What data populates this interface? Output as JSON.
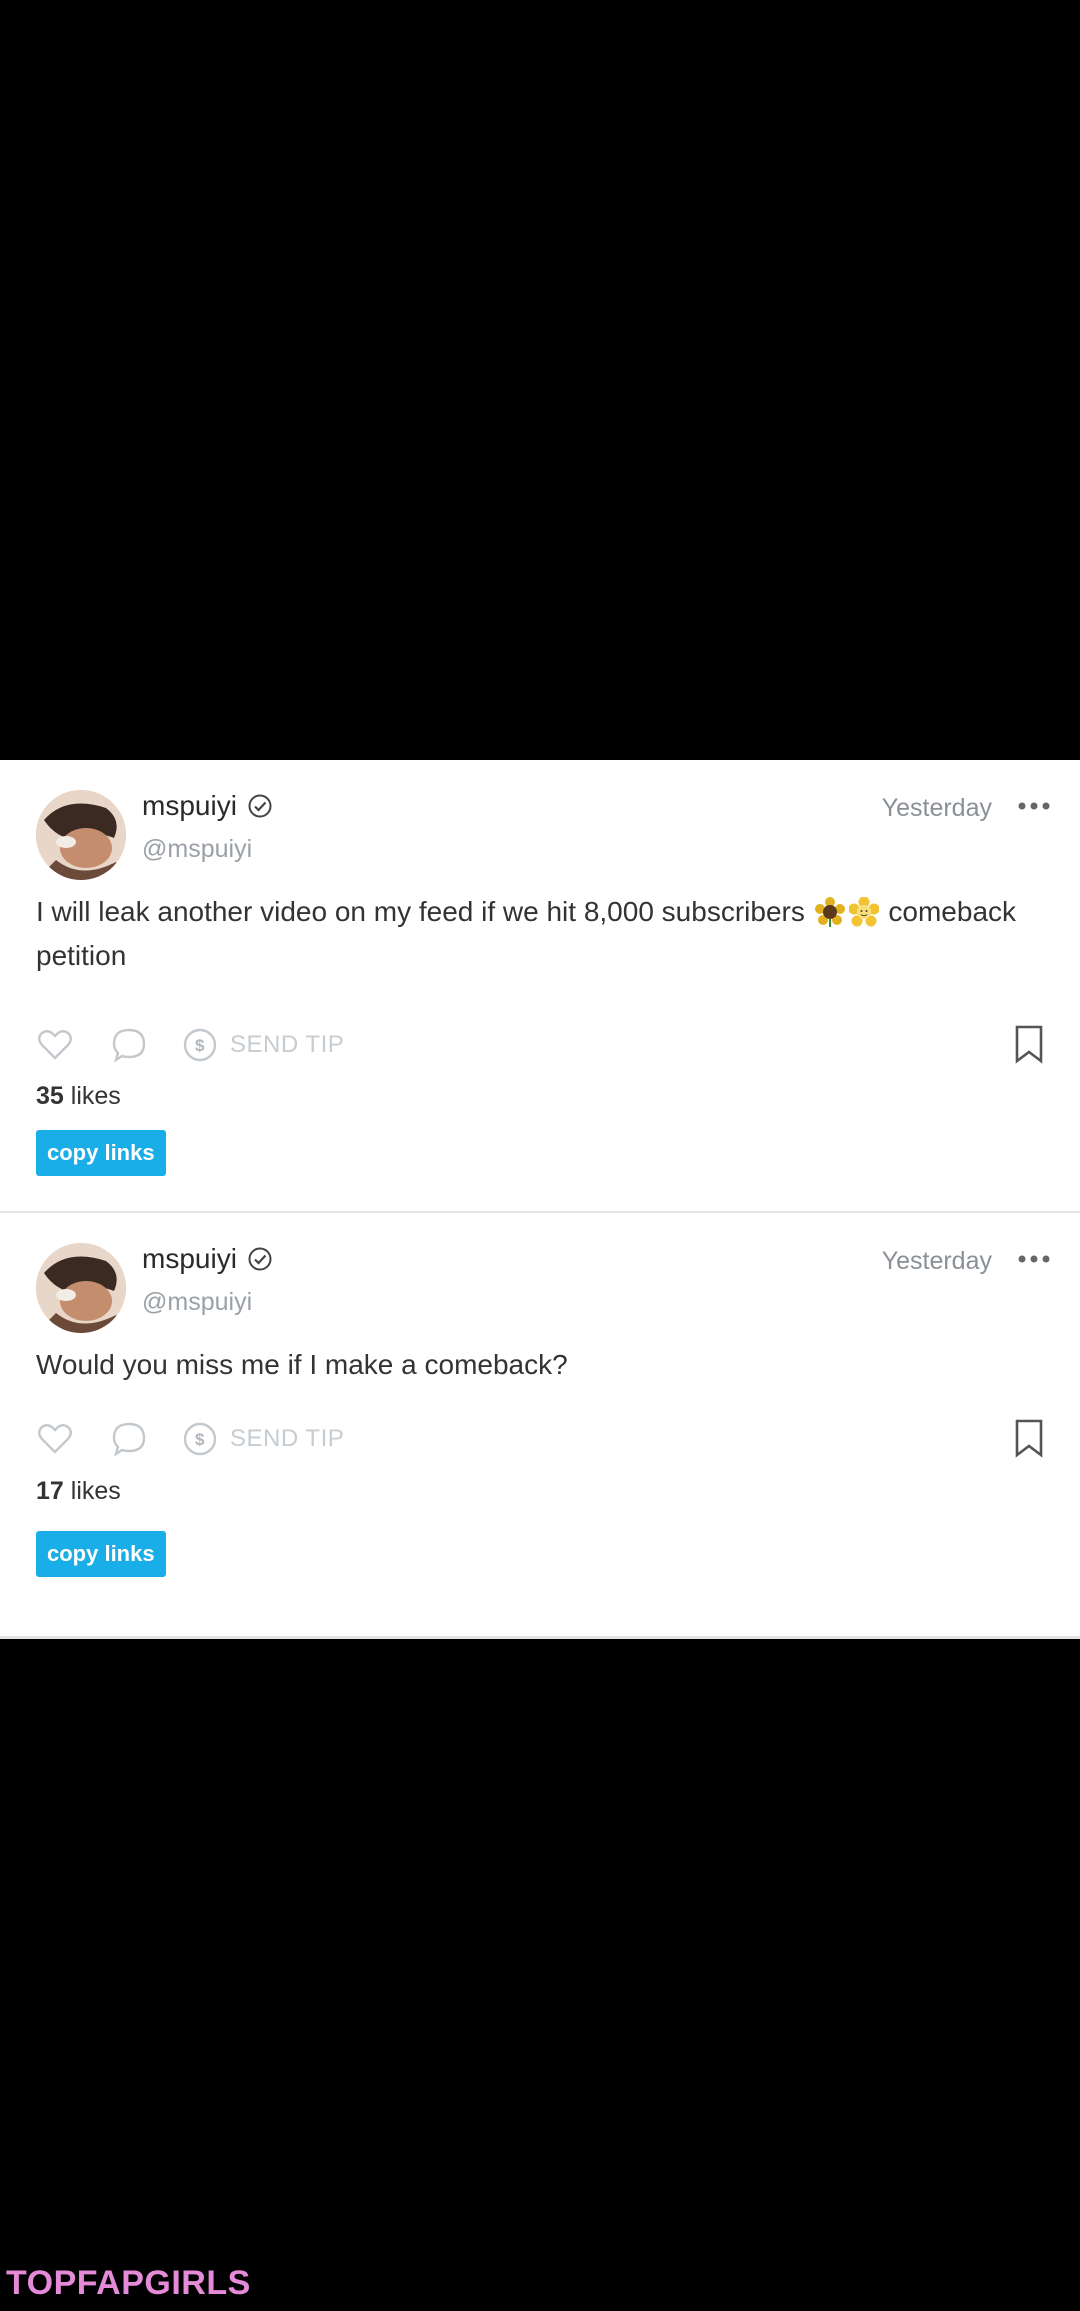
{
  "posts": [
    {
      "username": "mspuiyi",
      "handle": "@mspuiyi",
      "time": "Yesterday",
      "text_before": "I will leak another video on my feed if we hit 8,000 subscribers",
      "emojis": [
        "sunflower-emoji",
        "blossom-emoji"
      ],
      "text_after": "comeback petition",
      "send_tip_label": "SEND TIP",
      "likes_count": "35",
      "likes_label": "likes",
      "copy_label": "copy links"
    },
    {
      "username": "mspuiyi",
      "handle": "@mspuiyi",
      "time": "Yesterday",
      "text_before": "Would you miss me if I make a comeback?",
      "emojis": [],
      "text_after": "",
      "send_tip_label": "SEND TIP",
      "likes_count": "17",
      "likes_label": "likes",
      "copy_label": "copy links"
    }
  ],
  "watermark": "TOPFAPGIRLS",
  "colors": {
    "accent": "#1aaee8",
    "watermark": "#e48ad8",
    "muted": "#c7ccd1"
  },
  "icons": [
    "verified-check-icon",
    "more-dots-icon",
    "heart-icon",
    "comment-icon",
    "dollar-icon",
    "bookmark-icon"
  ]
}
